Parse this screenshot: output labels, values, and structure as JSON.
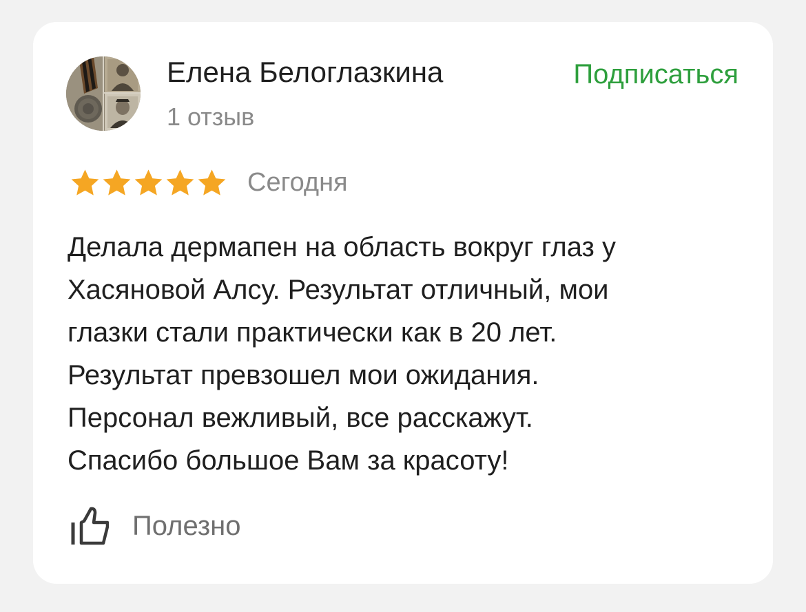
{
  "review": {
    "author": {
      "name": "Елена Белоглазкина",
      "review_count": "1 отзыв",
      "avatar_icon": "avatar-photo-collage"
    },
    "subscribe_label": "Подписаться",
    "rating": {
      "value": 5,
      "max": 5,
      "star_color": "#f5a623",
      "icon": "star-icon"
    },
    "date": "Сегодня",
    "text_lines": [
      "Делала дермапен на область вокруг глаз у",
      "Хасяновой Алсу. Результат отличный, мои",
      "глазки стали практически как в 20 лет.",
      "Результат превзошел мои ожидания.",
      "Персонал вежливый, все расскажут.",
      "Спасибо большое Вам за красоту!"
    ],
    "helpful": {
      "label": "Полезно",
      "icon": "thumbs-up-icon"
    }
  },
  "colors": {
    "background": "#f2f2f2",
    "card": "#ffffff",
    "accent_green": "#2e9f3d",
    "text_primary": "#1f1f1f",
    "text_secondary": "#8a8a8a"
  }
}
